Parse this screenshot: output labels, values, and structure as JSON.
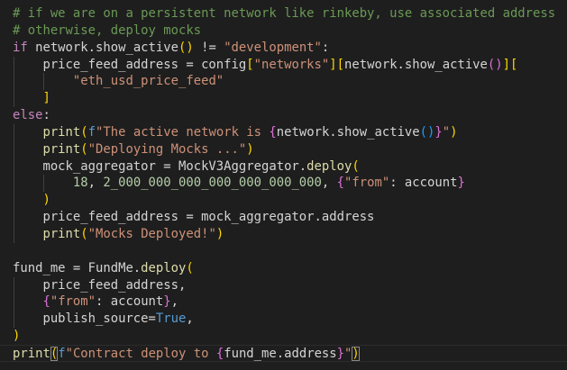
{
  "editor": {
    "language": "python",
    "token_colors": {
      "cm": "#6a9955",
      "kw": "#c586c0",
      "v": "#d4d4d4",
      "fn": "#dcdcaa",
      "s": "#ce9178",
      "n": "#b5cea8",
      "c": "#569cd6",
      "b1": "#ffd700",
      "b2": "#da70d6",
      "b3": "#179fff"
    },
    "current_line": 20,
    "lines": [
      {
        "indent": 0,
        "tokens": [
          [
            "cm",
            "# if we are on a persistent network like rinkeby, use associated address"
          ]
        ]
      },
      {
        "indent": 0,
        "tokens": [
          [
            "cm",
            "# otherwise, deploy mocks"
          ]
        ]
      },
      {
        "indent": 0,
        "tokens": [
          [
            "kw",
            "if"
          ],
          [
            "v",
            " network.show_active"
          ],
          [
            "b1",
            "()"
          ],
          [
            "p",
            " != "
          ],
          [
            "s",
            "\"development\""
          ],
          [
            "p",
            ":"
          ]
        ]
      },
      {
        "indent": 1,
        "tokens": [
          [
            "v",
            "price_feed_address = config"
          ],
          [
            "b1",
            "["
          ],
          [
            "s",
            "\"networks\""
          ],
          [
            "b1",
            "]["
          ],
          [
            "v",
            "network.show_active"
          ],
          [
            "b2",
            "()"
          ],
          [
            "b1",
            "]["
          ]
        ]
      },
      {
        "indent": 2,
        "tokens": [
          [
            "s",
            "\"eth_usd_price_feed\""
          ]
        ]
      },
      {
        "indent": 1,
        "tokens": [
          [
            "b1",
            "]"
          ]
        ]
      },
      {
        "indent": 0,
        "tokens": [
          [
            "kw",
            "else"
          ],
          [
            "p",
            ":"
          ]
        ]
      },
      {
        "indent": 1,
        "tokens": [
          [
            "fn",
            "print"
          ],
          [
            "b1",
            "("
          ],
          [
            "c",
            "f"
          ],
          [
            "s",
            "\"The active network is "
          ],
          [
            "b2",
            "{"
          ],
          [
            "v",
            "network.show_active"
          ],
          [
            "b3",
            "()"
          ],
          [
            "b2",
            "}"
          ],
          [
            "s",
            "\""
          ],
          [
            "b1",
            ")"
          ]
        ]
      },
      {
        "indent": 1,
        "tokens": [
          [
            "fn",
            "print"
          ],
          [
            "b1",
            "("
          ],
          [
            "s",
            "\"Deploying Mocks ...\""
          ],
          [
            "b1",
            ")"
          ]
        ]
      },
      {
        "indent": 1,
        "tokens": [
          [
            "v",
            "mock_aggregator = MockV3Aggregator."
          ],
          [
            "fn",
            "deploy"
          ],
          [
            "b1",
            "("
          ]
        ]
      },
      {
        "indent": 2,
        "tokens": [
          [
            "n",
            "18"
          ],
          [
            "p",
            ", "
          ],
          [
            "n",
            "2_000_000_000_000_000_000_000"
          ],
          [
            "p",
            ", "
          ],
          [
            "b2",
            "{"
          ],
          [
            "s",
            "\"from\""
          ],
          [
            "p",
            ": account"
          ],
          [
            "b2",
            "}"
          ]
        ]
      },
      {
        "indent": 1,
        "tokens": [
          [
            "b1",
            ")"
          ]
        ]
      },
      {
        "indent": 1,
        "tokens": [
          [
            "v",
            "price_feed_address = mock_aggregator.address"
          ]
        ]
      },
      {
        "indent": 1,
        "tokens": [
          [
            "fn",
            "print"
          ],
          [
            "b1",
            "("
          ],
          [
            "s",
            "\"Mocks Deployed!\""
          ],
          [
            "b1",
            ")"
          ]
        ]
      },
      {
        "indent": 0,
        "tokens": []
      },
      {
        "indent": 0,
        "tokens": [
          [
            "v",
            "fund_me = FundMe."
          ],
          [
            "fn",
            "deploy"
          ],
          [
            "b1",
            "("
          ]
        ]
      },
      {
        "indent": 1,
        "tokens": [
          [
            "v",
            "price_feed_address,"
          ]
        ]
      },
      {
        "indent": 1,
        "tokens": [
          [
            "b2",
            "{"
          ],
          [
            "s",
            "\"from\""
          ],
          [
            "p",
            ": account"
          ],
          [
            "b2",
            "}"
          ],
          [
            "p",
            ","
          ]
        ]
      },
      {
        "indent": 1,
        "tokens": [
          [
            "v",
            "publish_source="
          ],
          [
            "c",
            "True"
          ],
          [
            "p",
            ","
          ]
        ]
      },
      {
        "indent": 0,
        "tokens": [
          [
            "b1",
            ")"
          ]
        ]
      },
      {
        "indent": 0,
        "tokens": [
          [
            "fn",
            "print"
          ],
          [
            "b1",
            "(",
            "match"
          ],
          [
            "c",
            "f"
          ],
          [
            "s",
            "\"Contract deploy to "
          ],
          [
            "b2",
            "{"
          ],
          [
            "v",
            "fund_me.address"
          ],
          [
            "b2",
            "}"
          ],
          [
            "s",
            "\""
          ],
          [
            "b1",
            ")",
            "match"
          ]
        ]
      }
    ]
  }
}
